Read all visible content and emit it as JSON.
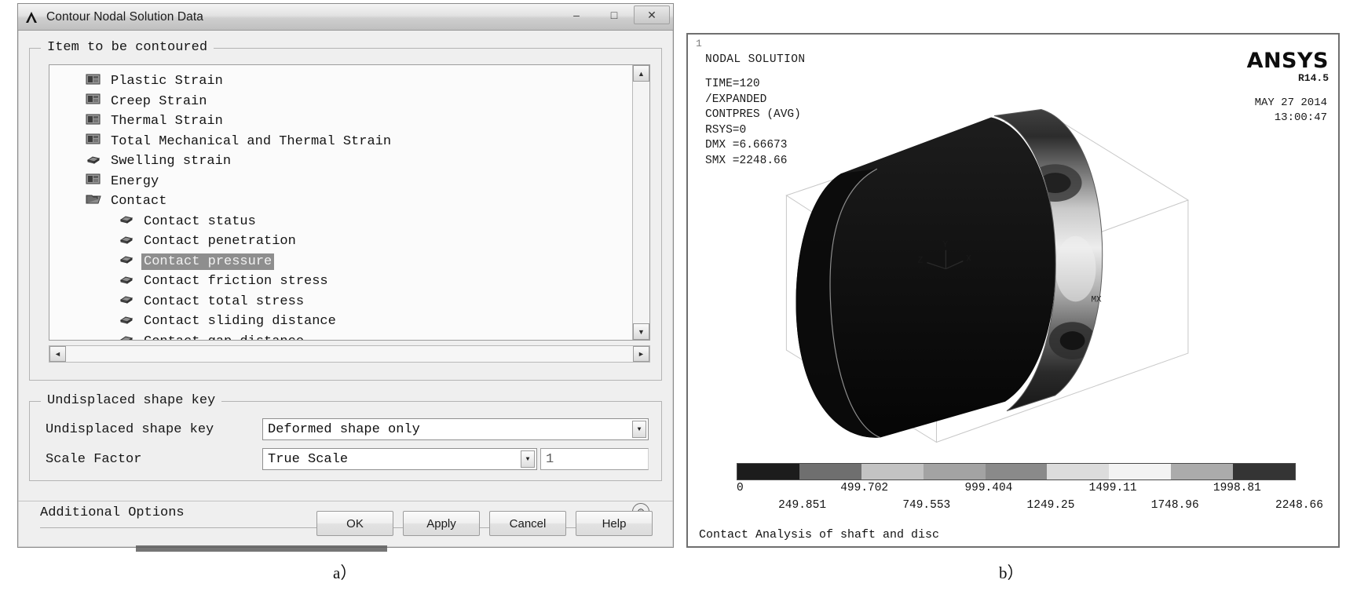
{
  "figure": {
    "caption_a": "a）",
    "caption_b": "b）"
  },
  "dialog": {
    "title": "Contour Nodal Solution Data",
    "app_icon": "ansys-a-icon",
    "window_buttons": [
      {
        "name": "minimize-button",
        "glyph": "–"
      },
      {
        "name": "maximize-button",
        "glyph": "□"
      },
      {
        "name": "close-button",
        "glyph": "✕"
      }
    ],
    "item_group": {
      "legend": "Item to be contoured",
      "items": [
        {
          "label": "Plastic Strain",
          "icon": "folder-icon",
          "indent": 0,
          "selected": false
        },
        {
          "label": "Creep Strain",
          "icon": "folder-icon",
          "indent": 0,
          "selected": false
        },
        {
          "label": "Thermal Strain",
          "icon": "folder-icon",
          "indent": 0,
          "selected": false
        },
        {
          "label": "Total Mechanical and Thermal Strain",
          "icon": "folder-icon",
          "indent": 0,
          "selected": false
        },
        {
          "label": "Swelling strain",
          "icon": "item-icon",
          "indent": 0,
          "selected": false
        },
        {
          "label": "Energy",
          "icon": "folder-icon",
          "indent": 0,
          "selected": false
        },
        {
          "label": "Contact",
          "icon": "open-folder-icon",
          "indent": 0,
          "selected": false
        },
        {
          "label": "Contact status",
          "icon": "item-icon",
          "indent": 1,
          "selected": false
        },
        {
          "label": "Contact penetration",
          "icon": "item-icon",
          "indent": 1,
          "selected": false
        },
        {
          "label": "Contact pressure",
          "icon": "item-icon",
          "indent": 1,
          "selected": true
        },
        {
          "label": "Contact friction stress",
          "icon": "item-icon",
          "indent": 1,
          "selected": false
        },
        {
          "label": "Contact total stress",
          "icon": "item-icon",
          "indent": 1,
          "selected": false
        },
        {
          "label": "Contact sliding distance",
          "icon": "item-icon",
          "indent": 1,
          "selected": false
        },
        {
          "label": "Contact gap distance",
          "icon": "item-icon",
          "indent": 1,
          "selected": false
        }
      ],
      "scroll_up_glyph": "▲",
      "scroll_down_glyph": "▼",
      "scroll_left_glyph": "◄",
      "scroll_right_glyph": "►"
    },
    "shape_group": {
      "legend": "Undisplaced shape key",
      "rows": [
        {
          "label": "Undisplaced shape key",
          "value": "Deformed shape only",
          "control": "combobox"
        },
        {
          "label": "Scale Factor",
          "value": "True Scale",
          "control": "combobox",
          "extra_value": "1"
        }
      ],
      "dropdown_glyph": "▼"
    },
    "additional_options": {
      "label": "Additional Options",
      "expander_glyph": "⊛"
    },
    "buttons": [
      {
        "label": "OK",
        "name": "ok-button"
      },
      {
        "label": "Apply",
        "name": "apply-button"
      },
      {
        "label": "Cancel",
        "name": "cancel-button"
      },
      {
        "label": "Help",
        "name": "help-button"
      }
    ]
  },
  "graphics": {
    "window_number": "1",
    "heading": "NODAL SOLUTION",
    "info_lines": [
      "TIME=120",
      "/EXPANDED",
      "CONTPRES (AVG)",
      "RSYS=0",
      "DMX =6.66673",
      "SMX =2248.66"
    ],
    "brand": "ANSYS",
    "release": "R14.5",
    "date": "MAY 27 2014",
    "time": "13:00:47",
    "axis_triad": {
      "x": "X",
      "y": "Y",
      "z": "Z"
    },
    "caption": "Contact Analysis of shaft and disc",
    "chart_data": {
      "type": "heatmap",
      "title": "Contact Analysis of shaft and disc",
      "quantity": "CONTPRES (AVG)",
      "unit_min": 0,
      "unit_max": 2248.66,
      "legend_position": "bottom",
      "bands": [
        {
          "from": 0,
          "to": 249.851,
          "color": "#1c1c1c"
        },
        {
          "from": 249.851,
          "to": 499.702,
          "color": "#6f6f6f"
        },
        {
          "from": 499.702,
          "to": 749.553,
          "color": "#c3c3c3"
        },
        {
          "from": 749.553,
          "to": 999.404,
          "color": "#a3a3a3"
        },
        {
          "from": 999.404,
          "to": 1249.25,
          "color": "#8a8a8a"
        },
        {
          "from": 1249.25,
          "to": 1499.11,
          "color": "#dcdcdc"
        },
        {
          "from": 1499.11,
          "to": 1748.96,
          "color": "#f3f3f3"
        },
        {
          "from": 1748.96,
          "to": 1998.81,
          "color": "#ababab"
        },
        {
          "from": 1998.81,
          "to": 2248.66,
          "color": "#343434"
        }
      ],
      "tick_labels_upper": [
        "0",
        "499.702",
        "999.404",
        "1499.11",
        "1998.81"
      ],
      "tick_labels_lower": [
        "249.851",
        "749.553",
        "1249.25",
        "1748.96",
        "2248.66"
      ]
    }
  }
}
